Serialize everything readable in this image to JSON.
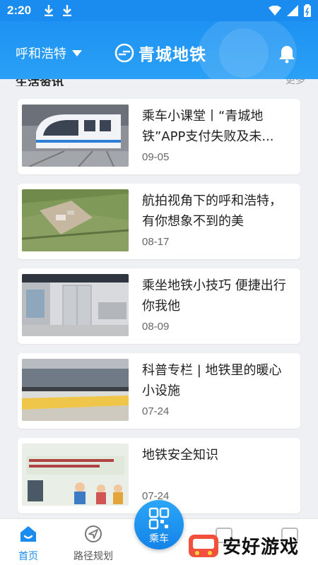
{
  "status_bar": {
    "time": "2:20"
  },
  "header": {
    "city": "呼和浩特",
    "brand": "青城地铁"
  },
  "section": {
    "title": "生活资讯",
    "more": "更多"
  },
  "news": [
    {
      "title": "乘车小课堂丨“青城地铁”APP支付失败及未...",
      "date": "09-05"
    },
    {
      "title": "航拍视角下的呼和浩特，有你想象不到的美",
      "date": "08-17"
    },
    {
      "title": "乘坐地铁小技巧 便捷出行你我他",
      "date": "08-09"
    },
    {
      "title": "科普专栏 | 地铁里的暖心小设施",
      "date": "07-24"
    },
    {
      "title": "地铁安全知识",
      "date": "07-24"
    }
  ],
  "bottom_nav": {
    "home": "首页",
    "route": "路径规划",
    "ride": "乘车"
  },
  "watermark": {
    "text": "安好游戏"
  },
  "colors": {
    "primary": "#1a8cf0",
    "card": "#ffffff",
    "background": "#eef0f3"
  }
}
